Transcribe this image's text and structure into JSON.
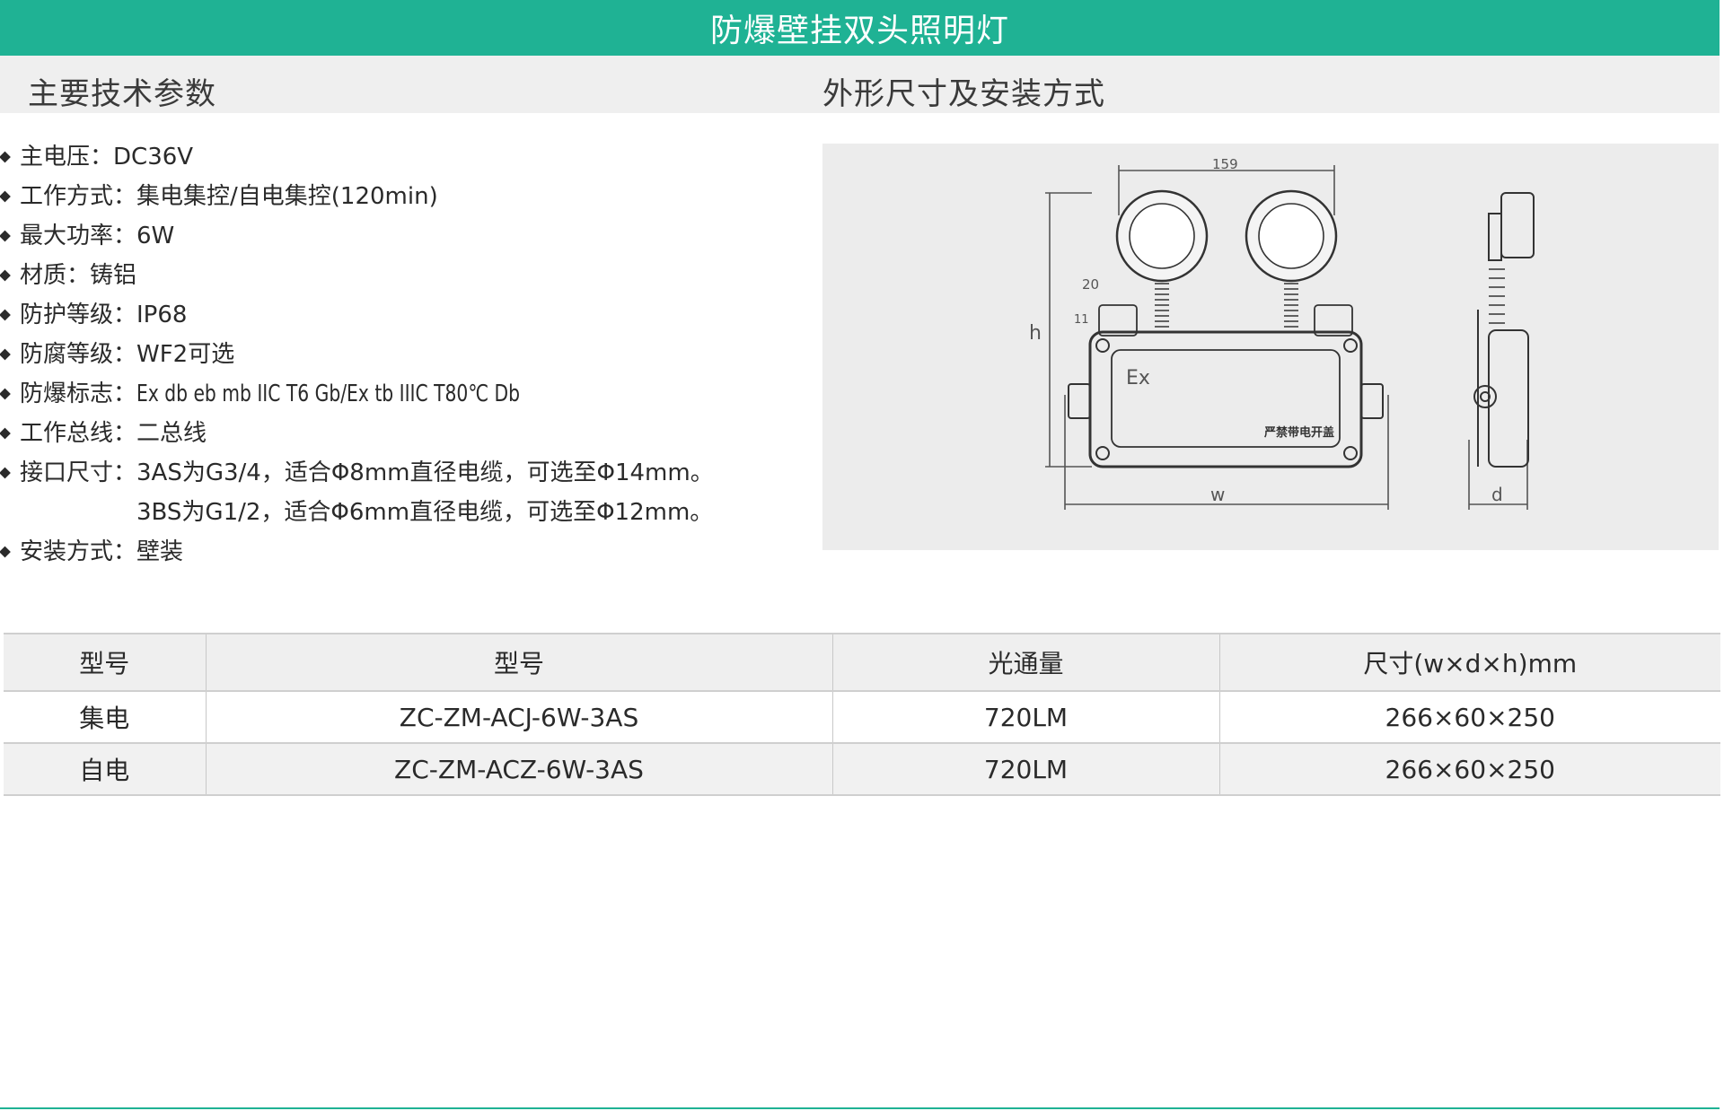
{
  "title": "防爆壁挂双头照明灯",
  "sections": {
    "params_title": "主要技术参数",
    "dims_title": "外形尺寸及安装方式"
  },
  "specs": [
    {
      "label": "主电压：",
      "value": "DC36V"
    },
    {
      "label": "工作方式：",
      "value": "集电集控/自电集控(120min)"
    },
    {
      "label": "最大功率：",
      "value": "6W"
    },
    {
      "label": "材质：",
      "value": "铸铝"
    },
    {
      "label": "防护等级：",
      "value": "IP68"
    },
    {
      "label": "防腐等级：",
      "value": "WF2可选"
    },
    {
      "label": "防爆标志：",
      "value": "Ex db eb mb IIC T6 Gb/Ex tb IIIC T80℃ Db"
    },
    {
      "label": "工作总线：",
      "value": "二总线"
    },
    {
      "label": "接口尺寸：",
      "value": "3AS为G3/4，适合Φ8mm直径电缆，可选至Φ14mm。"
    },
    {
      "label": "",
      "value": "3BS为G1/2，适合Φ6mm直径电缆，可选至Φ12mm。"
    },
    {
      "label": "安装方式：",
      "value": "壁装"
    }
  ],
  "drawing": {
    "dim_159": "159",
    "dim_20": "20",
    "dim_11": "11",
    "dim_h": "h",
    "dim_w": "w",
    "dim_d": "d",
    "mark_ex": "Ex",
    "warning_text": "严禁带电开盖"
  },
  "table": {
    "headers": [
      "型号",
      "型号",
      "光通量",
      "尺寸(w×d×h)mm"
    ],
    "rows": [
      [
        "集电",
        "ZC-ZM-ACJ-6W-3AS",
        "720LM",
        "266×60×250"
      ],
      [
        "自电",
        "ZC-ZM-ACZ-6W-3AS",
        "720LM",
        "266×60×250"
      ]
    ]
  }
}
